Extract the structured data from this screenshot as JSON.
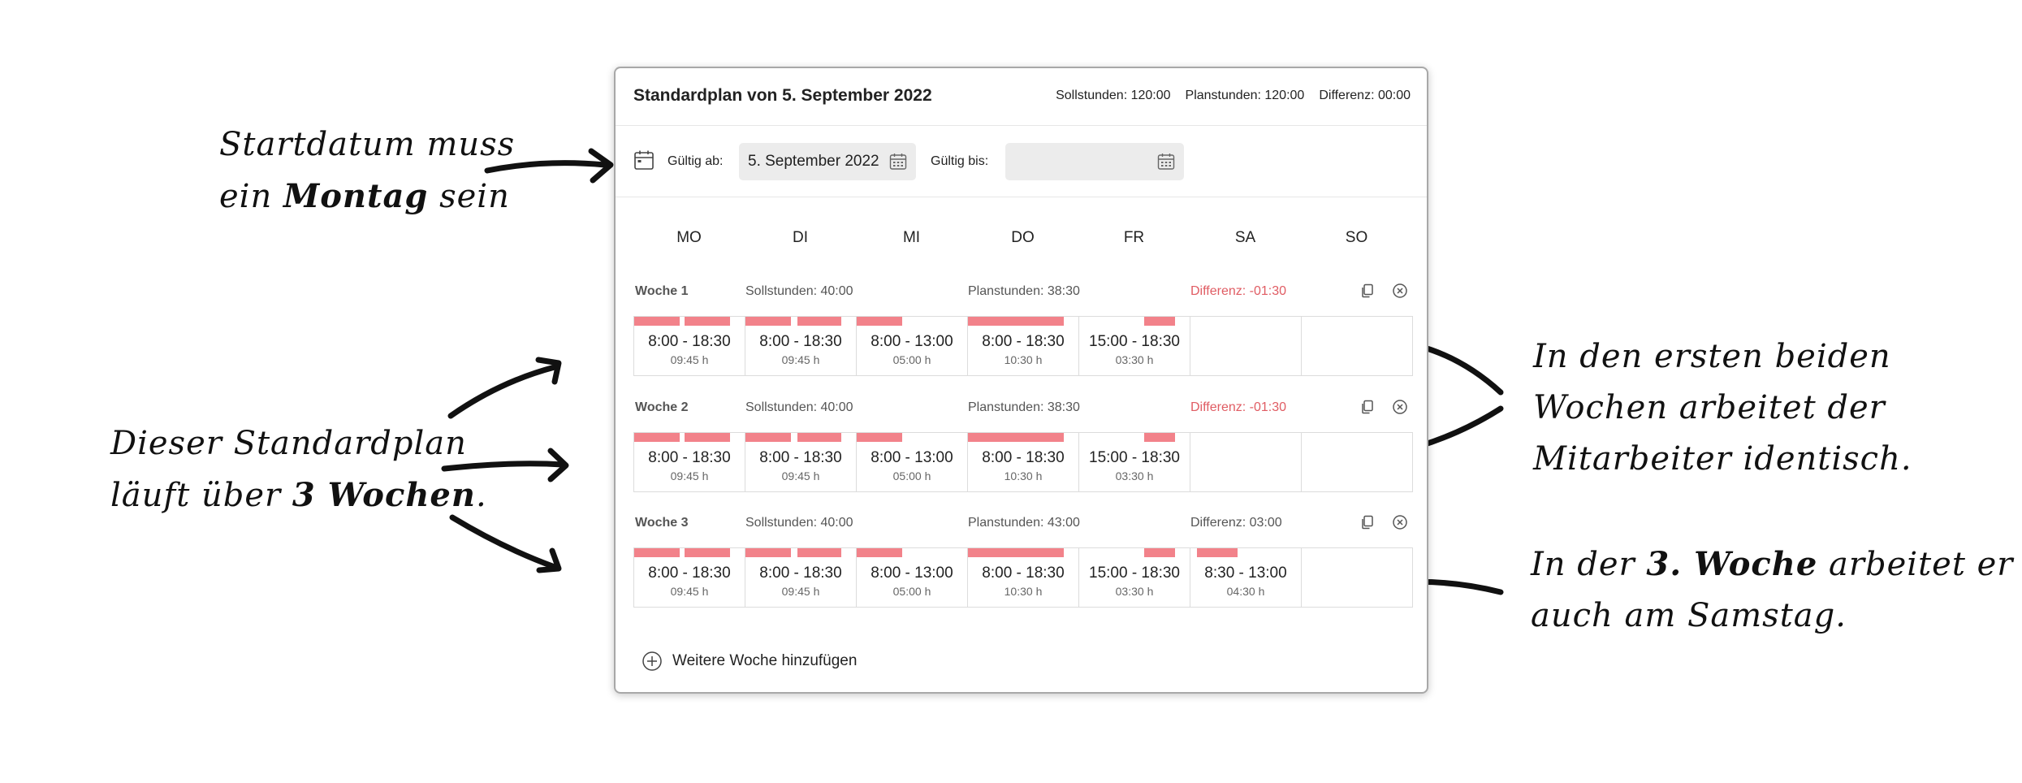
{
  "plan": {
    "title": "Standardplan von 5. September 2022",
    "sollstunden": "Sollstunden: 120:00",
    "planstunden": "Planstunden: 120:00",
    "differenz": "Differenz: 00:00"
  },
  "validity": {
    "from_label": "Gültig ab:",
    "from_value": "5. September 2022",
    "to_label": "Gültig bis:",
    "to_value": ""
  },
  "days": [
    "MO",
    "DI",
    "MI",
    "DO",
    "FR",
    "SA",
    "SO"
  ],
  "weeks": [
    {
      "label": "Woche 1",
      "soll": "Sollstunden: 40:00",
      "plan": "Planstunden: 38:30",
      "diff": "Differenz: -01:30",
      "diff_negative": true,
      "cells": [
        {
          "time": "8:00 - 18:30",
          "dur": "09:45 h"
        },
        {
          "time": "8:00 - 18:30",
          "dur": "09:45 h"
        },
        {
          "time": "8:00 - 13:00",
          "dur": "05:00 h"
        },
        {
          "time": "8:00 - 18:30",
          "dur": "10:30 h"
        },
        {
          "time": "15:00 - 18:30",
          "dur": "03:30 h"
        },
        {
          "time": "",
          "dur": ""
        },
        {
          "time": "",
          "dur": ""
        }
      ]
    },
    {
      "label": "Woche 2",
      "soll": "Sollstunden: 40:00",
      "plan": "Planstunden: 38:30",
      "diff": "Differenz: -01:30",
      "diff_negative": true,
      "cells": [
        {
          "time": "8:00 - 18:30",
          "dur": "09:45 h"
        },
        {
          "time": "8:00 - 18:30",
          "dur": "09:45 h"
        },
        {
          "time": "8:00 - 13:00",
          "dur": "05:00 h"
        },
        {
          "time": "8:00 - 18:30",
          "dur": "10:30 h"
        },
        {
          "time": "15:00 - 18:30",
          "dur": "03:30 h"
        },
        {
          "time": "",
          "dur": ""
        },
        {
          "time": "",
          "dur": ""
        }
      ]
    },
    {
      "label": "Woche 3",
      "soll": "Sollstunden: 40:00",
      "plan": "Planstunden: 43:00",
      "diff": "Differenz: 03:00",
      "diff_negative": false,
      "cells": [
        {
          "time": "8:00 - 18:30",
          "dur": "09:45 h"
        },
        {
          "time": "8:00 - 18:30",
          "dur": "09:45 h"
        },
        {
          "time": "8:00 - 13:00",
          "dur": "05:00 h"
        },
        {
          "time": "8:00 - 18:30",
          "dur": "10:30 h"
        },
        {
          "time": "15:00 - 18:30",
          "dur": "03:30 h"
        },
        {
          "time": "8:30 - 13:00",
          "dur": "04:30 h"
        },
        {
          "time": "",
          "dur": ""
        }
      ]
    }
  ],
  "add_week_label": "Weitere Woche hinzufügen",
  "annotations": {
    "start_1": "Startdatum muss",
    "start_2a": "ein ",
    "start_2b": "Montag",
    "start_2c": " sein",
    "plan_1": "Dieser Standardplan",
    "plan_2a": "läuft über ",
    "plan_2b": "3 Wochen",
    "plan_2c": ".",
    "same_1": "In den ersten beiden",
    "same_2": "Wochen arbeitet der",
    "same_3": "Mitarbeiter identisch.",
    "w3_1a": "In der ",
    "w3_1b": "3. Woche",
    "w3_1c": " arbeitet er",
    "w3_2": "auch am Samstag."
  },
  "colors": {
    "shift_bar": "#f2828a",
    "negative": "#e05c63"
  }
}
